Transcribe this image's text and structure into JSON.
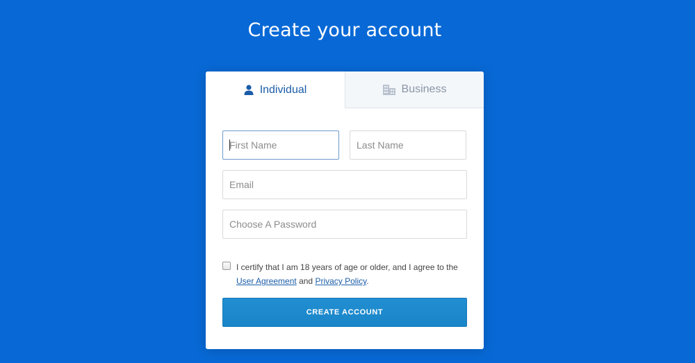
{
  "page": {
    "title": "Create your account"
  },
  "tabs": [
    {
      "label": "Individual",
      "icon": "person-icon",
      "active": true
    },
    {
      "label": "Business",
      "icon": "building-icon",
      "active": false
    }
  ],
  "form": {
    "first_name": {
      "placeholder": "First Name",
      "value": ""
    },
    "last_name": {
      "placeholder": "Last Name",
      "value": ""
    },
    "email": {
      "placeholder": "Email",
      "value": ""
    },
    "password": {
      "placeholder": "Choose A Password",
      "value": ""
    },
    "certify": {
      "checked": false,
      "text": "I certify that I am 18 years of age or older, and I agree to the",
      "link1": "User Agreement",
      "between": "and",
      "link2": "Privacy Policy",
      "end": "."
    },
    "submit_label": "CREATE ACCOUNT"
  },
  "colors": {
    "background": "#0869d6",
    "accent": "#1a5ca8",
    "button": "#1f8bce"
  }
}
